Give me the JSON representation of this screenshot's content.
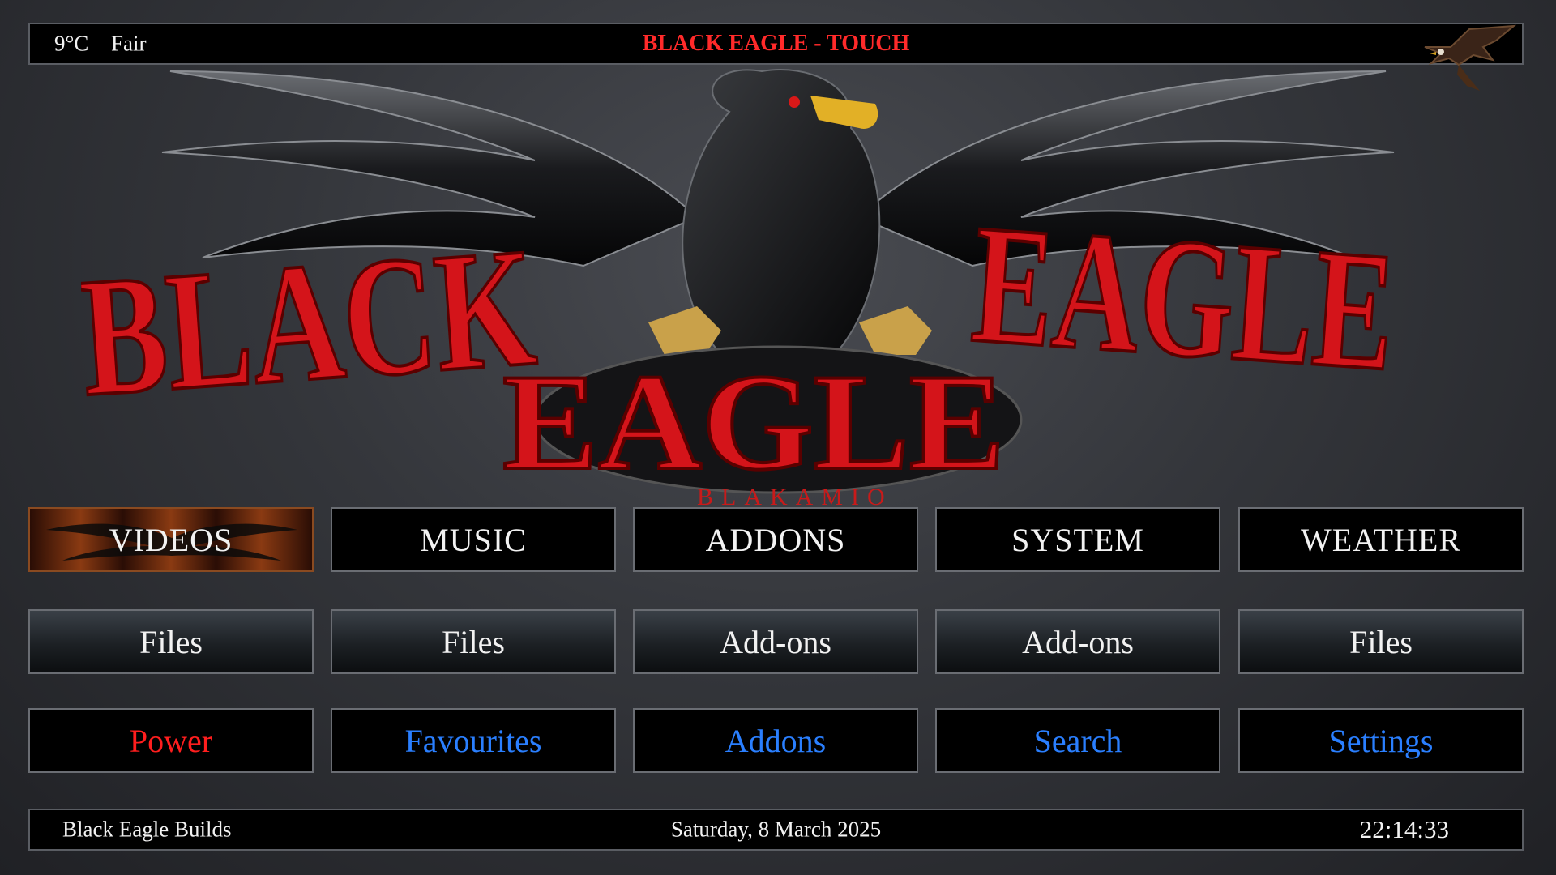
{
  "header": {
    "temperature": "9°C",
    "condition": "Fair",
    "title": "BLACK EAGLE - TOUCH"
  },
  "logo": {
    "line1_left": "BLACK",
    "line1_right": "EAGLE",
    "line2": "EAGLE",
    "tagline": "BLAKAMIO"
  },
  "main_menu": {
    "items": [
      {
        "label": "VIDEOS",
        "focused": true
      },
      {
        "label": "MUSIC"
      },
      {
        "label": "ADDONS"
      },
      {
        "label": "SYSTEM"
      },
      {
        "label": "WEATHER"
      }
    ]
  },
  "sub_menu": {
    "items": [
      {
        "label": "Files"
      },
      {
        "label": "Files"
      },
      {
        "label": "Add-ons"
      },
      {
        "label": "Add-ons"
      },
      {
        "label": "Files"
      }
    ]
  },
  "shortcuts": {
    "items": [
      {
        "label": "Power",
        "color": "#ff1e1e"
      },
      {
        "label": "Favourites",
        "color": "#2a7fff"
      },
      {
        "label": "Addons",
        "color": "#2a7fff"
      },
      {
        "label": "Search",
        "color": "#2a7fff"
      },
      {
        "label": "Settings",
        "color": "#2a7fff"
      }
    ]
  },
  "footer": {
    "builder": "Black Eagle Builds",
    "date": "Saturday, 8 March 2025",
    "time": "22:14:33"
  },
  "colors": {
    "accent_red": "#ff2a2a",
    "link_blue": "#2a7fff"
  }
}
